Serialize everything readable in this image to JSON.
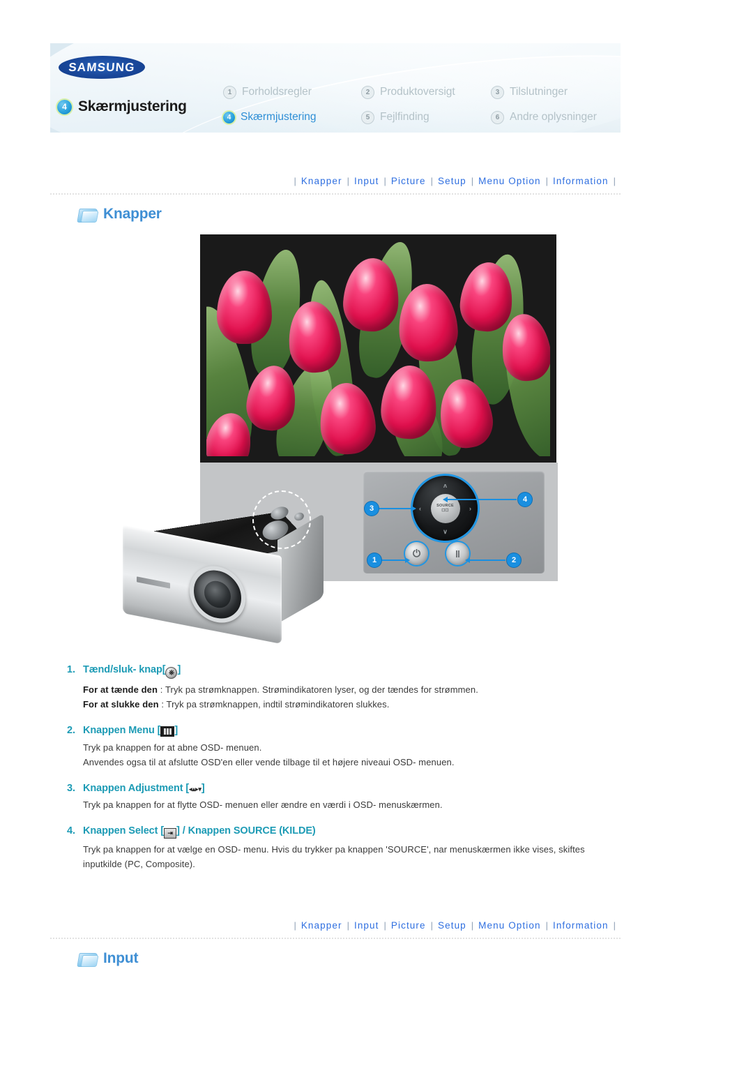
{
  "header": {
    "logo_text": "SAMSUNG",
    "active_section_number": "4",
    "active_section_title": "Skærmjustering",
    "menu": [
      {
        "number": "1",
        "label": "Forholdsregler",
        "active": false
      },
      {
        "number": "2",
        "label": "Produktoversigt",
        "active": false
      },
      {
        "number": "3",
        "label": "Tilslutninger",
        "active": false
      },
      {
        "number": "4",
        "label": "Skærmjustering",
        "active": true
      },
      {
        "number": "5",
        "label": "Fejlfinding",
        "active": false
      },
      {
        "number": "6",
        "label": "Andre oplysninger",
        "active": false
      }
    ]
  },
  "nav": {
    "separator": "|",
    "links": [
      "Knapper",
      "Input",
      "Picture",
      "Setup",
      "Menu Option",
      "Information"
    ]
  },
  "sections": {
    "knapper_title": "Knapper",
    "input_title": "Input"
  },
  "figure": {
    "source_button_label": "SOURCE",
    "dpad_arrows": {
      "up": "ʌ",
      "down": "∨",
      "left": "‹",
      "right": "›"
    },
    "power_glyph": "⏻",
    "menu_glyph": "‖",
    "callouts": [
      "1",
      "2",
      "3",
      "4"
    ]
  },
  "items": [
    {
      "number": "1.",
      "title": "Tænd/sluk- knap",
      "bracket_open": "[",
      "bracket_close": "]",
      "icon": "power-icon",
      "lines": [
        {
          "bold": "For at tænde den",
          "rest": " : Tryk pa strømknappen. Strømindikatoren lyser, og der tændes for strømmen."
        },
        {
          "bold": "For at slukke den",
          "rest": " : Tryk pa strømknappen, indtil strømindikatoren slukkes."
        }
      ]
    },
    {
      "number": "2.",
      "title": "Knappen Menu",
      "bracket_open": "[",
      "bracket_close": "]",
      "icon": "menu-icon",
      "lines": [
        {
          "bold": "",
          "rest": "Tryk pa knappen for at abne OSD- menuen."
        },
        {
          "bold": "",
          "rest": "Anvendes ogsa til at afslutte OSD'en eller vende tilbage til et højere niveaui OSD- menuen."
        }
      ]
    },
    {
      "number": "3.",
      "title": "Knappen Adjustment",
      "bracket_open": "[",
      "bracket_close": "]",
      "icon": "arrows-icon",
      "lines": [
        {
          "bold": "",
          "rest": "Tryk pa knappen for at flytte OSD- menuen eller ændre en værdi i OSD- menuskærmen."
        }
      ]
    },
    {
      "number": "4.",
      "title": "Knappen Select",
      "title_suffix": " / Knappen SOURCE (KILDE)",
      "bracket_open": "[",
      "bracket_close": "]",
      "icon": "select-icon",
      "lines": [
        {
          "bold": "",
          "rest": "Tryk pa knappen for at vælge en OSD- menu. Hvis du trykker pa knappen 'SOURCE', nar menuskærmen ikke vises, skiftes inputkilde (PC, Composite)."
        }
      ]
    }
  ],
  "colors": {
    "nav_link": "#2f6fe0",
    "item_heading": "#1d9bb5",
    "section_heading": "#3f8fd4",
    "callout": "#1a8fe0"
  }
}
